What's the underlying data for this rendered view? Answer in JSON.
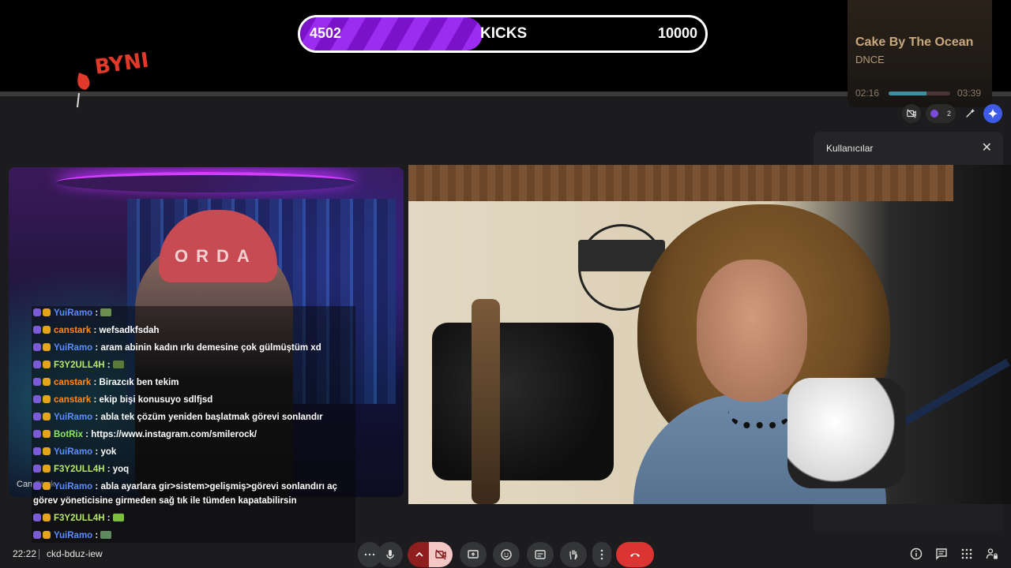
{
  "kicks": {
    "current": "4502",
    "label": "KICKS",
    "goal": "10000",
    "progress": 0.4502
  },
  "logo": {
    "text": "BYNI"
  },
  "now_playing": {
    "title": "Cake By The Ocean",
    "artist": "DNCE",
    "elapsed": "02:16",
    "duration": "03:39",
    "progress": 0.62
  },
  "top_icons": {
    "participants_count": "2"
  },
  "users_panel": {
    "title": "Kullanıcılar"
  },
  "tiles": {
    "left_name": "Can Stark",
    "cap_text": "ORDA"
  },
  "chat": [
    {
      "user": "YuiRamo",
      "color": "#5b8cff",
      "message": "",
      "emote": "#6b8f4e"
    },
    {
      "user": "canstark",
      "color": "#ff8a1f",
      "message": ": wefsadkfsdah"
    },
    {
      "user": "YuiRamo",
      "color": "#5b8cff",
      "message": ": aram abinin kadın ırkı demesine çok gülmüştüm xd"
    },
    {
      "user": "F3Y2ULL4H",
      "color": "#b6e86a",
      "message": "",
      "emote": "#5a7a3a"
    },
    {
      "user": "canstark",
      "color": "#ff8a1f",
      "message": ": Birazcık ben tekim"
    },
    {
      "user": "canstark",
      "color": "#ff8a1f",
      "message": ": ekip bişi konusuyo sdlfjsd"
    },
    {
      "user": "YuiRamo",
      "color": "#5b8cff",
      "message": ": abla tek çözüm yeniden başlatmak görevi sonlandır"
    },
    {
      "user": "BotRix",
      "color": "#8fe866",
      "message": ": https://www.instagram.com/smilerock/"
    },
    {
      "user": "YuiRamo",
      "color": "#5b8cff",
      "message": ": yok"
    },
    {
      "user": "F3Y2ULL4H",
      "color": "#b6e86a",
      "message": ": yoq"
    },
    {
      "user": "YuiRamo",
      "color": "#5b8cff",
      "message": ": abla ayarlara gir>sistem>gelişmiş>görevi sonlandırı aç"
    },
    {
      "user": "",
      "color": "#ffffff",
      "message": "görev yöneticisine girmeden sağ tık ile tümden kapatabilirsin"
    },
    {
      "user": "F3Y2ULL4H",
      "color": "#b6e86a",
      "message": "",
      "emote": "#7bbf3a"
    },
    {
      "user": "YuiRamo",
      "color": "#5b8cff",
      "message": "",
      "emote": "#5f8a60"
    }
  ],
  "bottom": {
    "time": "22:22",
    "meeting_code": "ckd-bduz-iew"
  },
  "colors": {
    "accent_purple": "#8a1fd6",
    "hangup": "#dc3432"
  }
}
